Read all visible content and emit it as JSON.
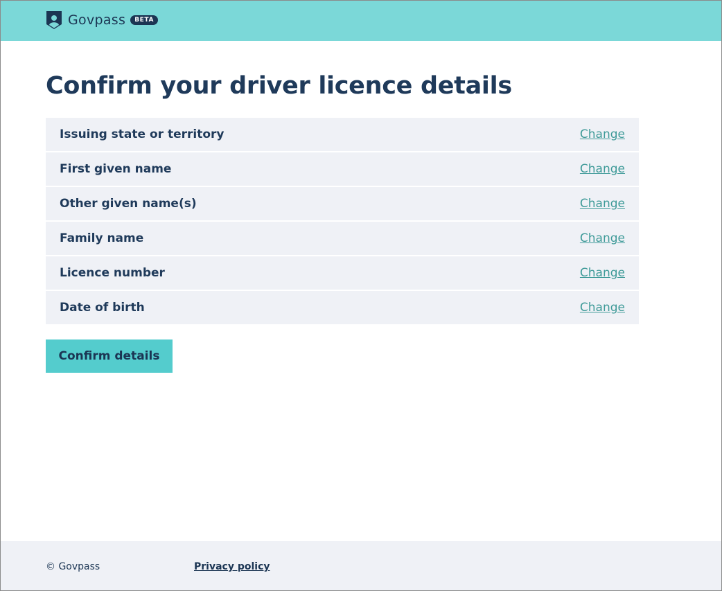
{
  "header": {
    "logo_icon": "shield-person-icon",
    "brand_name": "Govpass",
    "badge": "BETA"
  },
  "page": {
    "title": "Confirm your driver licence details"
  },
  "summary": {
    "rows": [
      {
        "label": "Issuing state or territory",
        "action": "Change"
      },
      {
        "label": "First given name",
        "action": "Change"
      },
      {
        "label": "Other given name(s)",
        "action": "Change"
      },
      {
        "label": "Family name",
        "action": "Change"
      },
      {
        "label": "Licence number",
        "action": "Change"
      },
      {
        "label": "Date of birth",
        "action": "Change"
      }
    ]
  },
  "actions": {
    "confirm_label": "Confirm details"
  },
  "footer": {
    "copyright": "© Govpass",
    "privacy_link": "Privacy policy"
  },
  "colors": {
    "header_bg": "#7bd8d8",
    "primary_text": "#1b3553",
    "link": "#3e9a98",
    "button_bg": "#54cccd",
    "row_bg": "#eff1f6"
  }
}
